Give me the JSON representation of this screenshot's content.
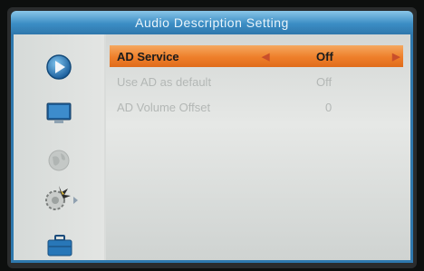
{
  "window": {
    "title": "Audio Description Setting"
  },
  "sidebar": {
    "items": [
      {
        "icon": "play-icon",
        "active": true
      },
      {
        "icon": "tv-icon",
        "active": false
      },
      {
        "icon": "globe-icon",
        "active": false
      },
      {
        "icon": "gear-icon",
        "active": false
      },
      {
        "icon": "briefcase-icon",
        "active": false
      }
    ]
  },
  "settings": [
    {
      "label": "AD Service",
      "value": "Off",
      "selected": true
    },
    {
      "label": "Use AD as default",
      "value": "Off",
      "selected": false
    },
    {
      "label": "AD Volume Offset",
      "value": "0",
      "selected": false
    }
  ],
  "colors": {
    "title_bar": "#3b8dc4",
    "highlight": "#ee7f2a",
    "panel": "#d9dcda"
  }
}
